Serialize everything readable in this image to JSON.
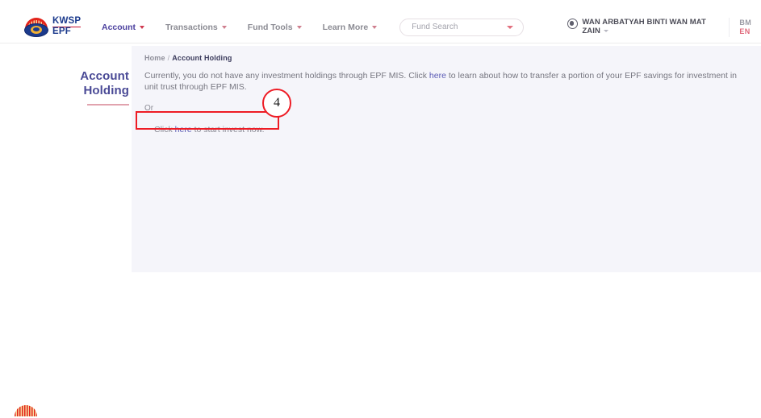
{
  "brand": {
    "logo_line1": "KWSP",
    "logo_line2": "EPF",
    "logo_icon": "kwsp-epf-logo"
  },
  "nav": {
    "items": [
      {
        "label": "Account",
        "active": true,
        "has_caret": true
      },
      {
        "label": "Transactions",
        "active": false,
        "has_caret": true
      },
      {
        "label": "Fund Tools",
        "active": false,
        "has_caret": true
      },
      {
        "label": "Learn More",
        "active": false,
        "has_caret": true
      }
    ]
  },
  "search": {
    "placeholder": "Fund Search",
    "value": "",
    "caret_icon": "chevron-down-icon"
  },
  "user": {
    "name": "WAN ARBATYAH BINTI WAN MAT ZAIN",
    "avatar_icon": "user-circle-icon",
    "caret_icon": "chevron-down-icon"
  },
  "language": {
    "options": [
      "BM",
      "EN"
    ],
    "bm": "BM",
    "en": "EN",
    "selected": "EN"
  },
  "breadcrumb": {
    "home": "Home",
    "separator": "/",
    "current": "Account Holding"
  },
  "side": {
    "title_line1": "Account",
    "title_line2": "Holding"
  },
  "main": {
    "paragraph_part1": "Currently, you do not have any investment holdings through EPF MIS. Click ",
    "paragraph_link": "here",
    "paragraph_part2": " to learn about how to transfer a portion of your EPF savings for investment in unit trust through EPF MIS.",
    "or_text": "Or",
    "invest_part1": "Click ",
    "invest_link": "here",
    "invest_part2": " to start invest now."
  },
  "annotation": {
    "step_number": "4",
    "color": "#ee1c25"
  },
  "colors": {
    "brand_blue": "#1b3a8c",
    "brand_red": "#e2231a",
    "accent_purple": "#4a4a96",
    "panel_bg": "#f5f5fa",
    "link": "#5a5ab5"
  }
}
